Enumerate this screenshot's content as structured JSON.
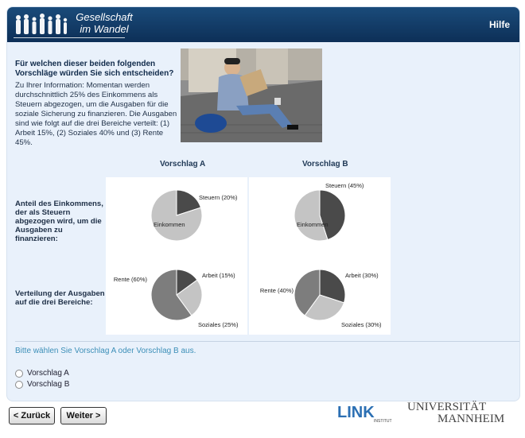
{
  "header": {
    "logo_line1": "Gesellschaft",
    "logo_line2": "im Wandel",
    "help_label": "Hilfe"
  },
  "question": "Für welchen dieser beiden folgenden Vorschläge würden Sie sich entscheiden?",
  "info": "Zu Ihrer Information: Momentan werden durchschnittlich 25% des Einkommens als Steuern abgezogen, um die Ausgaben für die soziale Sicherung zu finanzieren. Die Ausgaben sind wie folgt auf die drei Bereiche verteilt: (1) Arbeit 15%, (2) Soziales 40% und (3) Rente 45%.",
  "row_labels": {
    "income": "Anteil des Einkommens, der als Steuern abgezogen wird, um die Ausgaben zu finanzieren:",
    "spending": "Verteilung der Ausgaben auf die drei Bereiche:"
  },
  "proposals": [
    {
      "title": "Vorschlag A",
      "income_chart": {
        "tax_label": "Steuern (20%)",
        "rest_label": "Einkommen",
        "tax": 20
      },
      "spending_chart": {
        "arbeit_label": "Arbeit (15%)",
        "soziales_label": "Soziales (25%)",
        "rente_label": "Rente (60%)",
        "arbeit": 15,
        "soziales": 25,
        "rente": 60
      }
    },
    {
      "title": "Vorschlag B",
      "income_chart": {
        "tax_label": "Steuern (45%)",
        "rest_label": "Einkommen",
        "tax": 45
      },
      "spending_chart": {
        "arbeit_label": "Arbeit (30%)",
        "soziales_label": "Soziales (30%)",
        "rente_label": "Rente (40%)",
        "arbeit": 30,
        "soziales": 30,
        "rente": 40
      }
    }
  ],
  "prompt": "Bitte wählen Sie Vorschlag A oder Vorschlag B aus.",
  "options": [
    "Vorschlag A",
    "Vorschlag B"
  ],
  "nav": {
    "back": "< Zurück",
    "next": "Weiter >"
  },
  "footer": {
    "link_logo": "LINK",
    "link_sub": "INSTITUT",
    "uni_line1": "UNIVERSITÄT",
    "uni_line2": "MANNHEIM"
  },
  "colors": {
    "header": "#0d2f57",
    "frame": "#e9f1fb",
    "dark_slice": "#4a4a4a",
    "mid_slice": "#7d7d7d",
    "light_slice": "#c4c4c4",
    "prompt": "#3c8fb8"
  },
  "icons": [
    "people-silhouette-icon"
  ]
}
